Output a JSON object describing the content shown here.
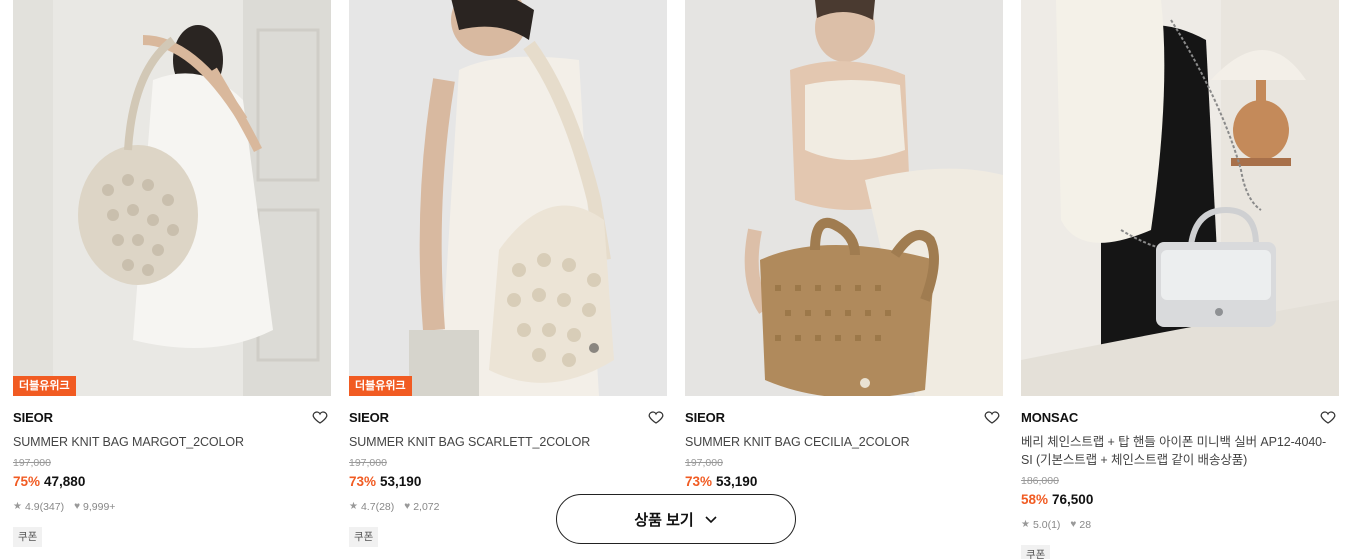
{
  "products": [
    {
      "tag": "더블유위크",
      "brand": "SIEOR",
      "name": "SUMMER KNIT BAG MARGOT_2COLOR",
      "original_price": "197,000",
      "discount": "75%",
      "price": "47,880",
      "rating": "4.9",
      "reviews": "(347)",
      "likes": "9,999+",
      "coupon": "쿠폰"
    },
    {
      "tag": "더블유위크",
      "brand": "SIEOR",
      "name": "SUMMER KNIT BAG SCARLETT_2COLOR",
      "original_price": "197,000",
      "discount": "73%",
      "price": "53,190",
      "rating": "4.7",
      "reviews": "(28)",
      "likes": "2,072",
      "coupon": "쿠폰"
    },
    {
      "brand": "SIEOR",
      "name": "SUMMER KNIT BAG CECILIA_2COLOR",
      "original_price": "197,000",
      "discount": "73%",
      "price": "53,190"
    },
    {
      "brand": "MONSAC",
      "name": "베리 체인스트랩 + 탑 핸들 아이폰 미니백 실버 AP12-4040-SI (기본스트랩 + 체인스트랩 같이 배송상품)",
      "original_price": "186,000",
      "discount": "58%",
      "price": "76,500",
      "rating": "5.0",
      "reviews": "(1)",
      "likes": "28",
      "coupon": "쿠폰"
    }
  ],
  "view_products_button": "상품 보기",
  "colors": {
    "accent": "#f15b22",
    "text": "#111111",
    "muted": "#999999"
  }
}
